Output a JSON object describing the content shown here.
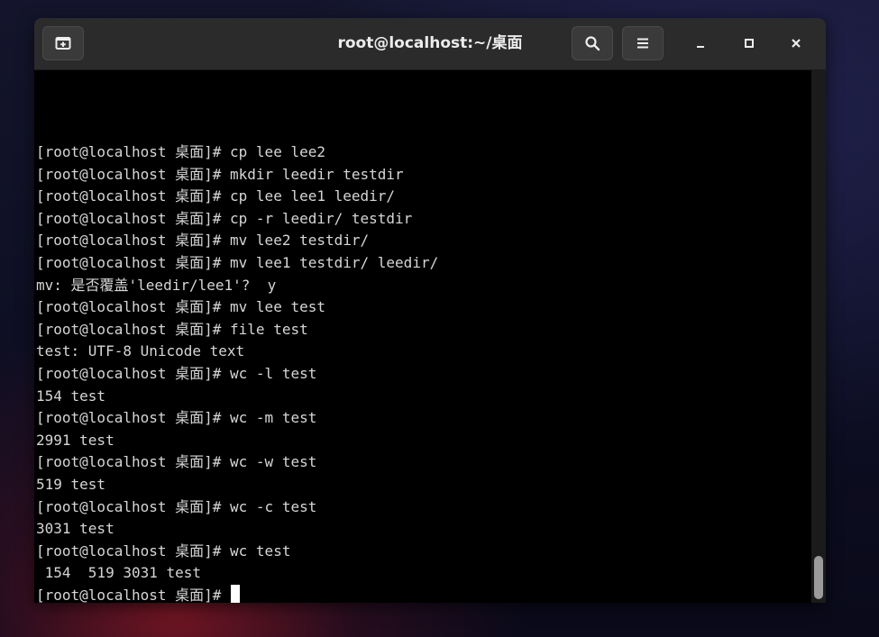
{
  "window": {
    "title": "root@localhost:~/桌面"
  },
  "titlebar": {
    "new_tab_icon": "new-tab-icon",
    "search_icon": "search-icon",
    "menu_icon": "hamburger-menu-icon",
    "minimize_icon": "minimize-icon",
    "maximize_icon": "maximize-icon",
    "close_icon": "close-icon"
  },
  "terminal": {
    "lines": [
      "[root@localhost 桌面]# cp lee lee2",
      "[root@localhost 桌面]# mkdir leedir testdir",
      "[root@localhost 桌面]# cp lee lee1 leedir/",
      "[root@localhost 桌面]# cp -r leedir/ testdir",
      "[root@localhost 桌面]# mv lee2 testdir/",
      "[root@localhost 桌面]# mv lee1 testdir/ leedir/",
      "mv: 是否覆盖'leedir/lee1'?  y",
      "[root@localhost 桌面]# mv lee test",
      "[root@localhost 桌面]# file test",
      "test: UTF-8 Unicode text",
      "[root@localhost 桌面]# wc -l test",
      "154 test",
      "[root@localhost 桌面]# wc -m test",
      "2991 test",
      "[root@localhost 桌面]# wc -w test",
      "519 test",
      "[root@localhost 桌面]# wc -c test",
      "3031 test",
      "[root@localhost 桌面]# wc test",
      " 154  519 3031 test"
    ],
    "prompt": "[root@localhost 桌面]# "
  },
  "colors": {
    "terminal_bg": "#000000",
    "terminal_fg": "#d6d6d6",
    "titlebar_bg": "#2b2b2b"
  }
}
